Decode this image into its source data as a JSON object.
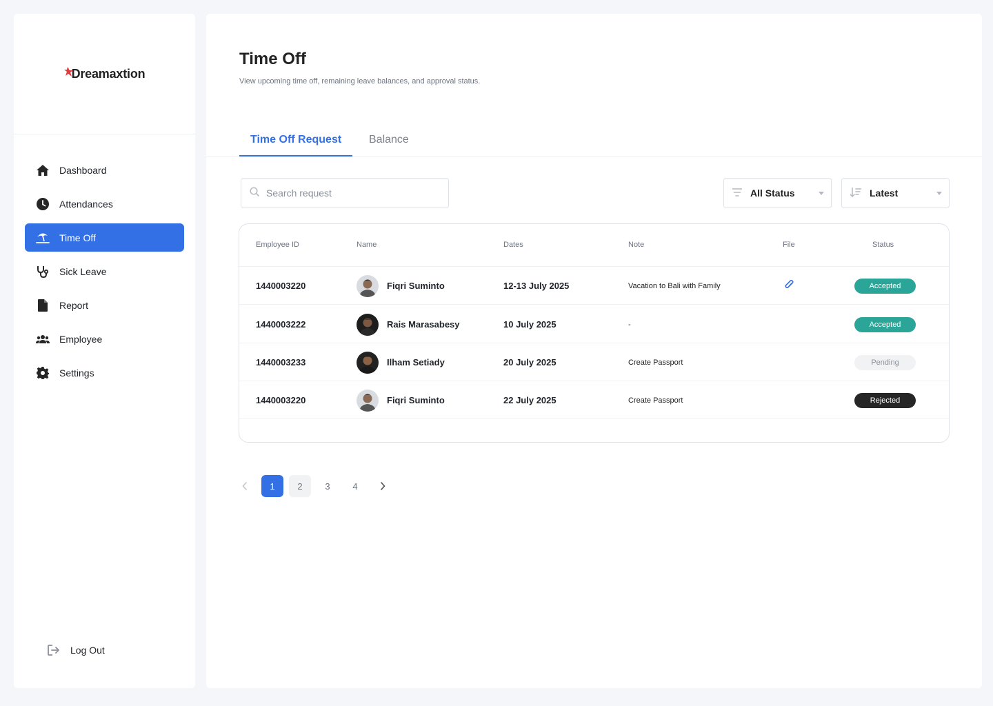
{
  "brand": {
    "logo_text": "Dreamaxtion",
    "accent": "#3370e6"
  },
  "sidebar": {
    "items": [
      {
        "label": "Dashboard",
        "icon": "home-icon"
      },
      {
        "label": "Attendances",
        "icon": "clock-icon"
      },
      {
        "label": "Time Off",
        "icon": "beach-umbrella-icon",
        "active": true
      },
      {
        "label": "Sick Leave",
        "icon": "stethoscope-icon"
      },
      {
        "label": "Report",
        "icon": "document-icon"
      },
      {
        "label": "Employee",
        "icon": "users-icon"
      },
      {
        "label": "Settings",
        "icon": "gear-icon"
      }
    ],
    "logout_label": "Log Out"
  },
  "header": {
    "title": "Time Off",
    "subtitle": "View upcoming time off, remaining leave balances, and approval status."
  },
  "tabs": [
    {
      "label": "Time Off Request",
      "active": true
    },
    {
      "label": "Balance",
      "active": false
    }
  ],
  "toolbar": {
    "search_placeholder": "Search request",
    "status_filter": "All Status",
    "sort": "Latest"
  },
  "table": {
    "columns": [
      "Employee ID",
      "Name",
      "Dates",
      "Note",
      "File",
      "Status"
    ],
    "rows": [
      {
        "id": "1440003220",
        "name": "Fiqri Suminto",
        "dates": "12-13 July 2025",
        "note": "Vacation to Bali with Family",
        "has_file": true,
        "status": "Accepted"
      },
      {
        "id": "1440003222",
        "name": "Rais Marasabesy",
        "dates": "10 July 2025",
        "note": "-",
        "has_file": false,
        "status": "Accepted"
      },
      {
        "id": "1440003233",
        "name": "Ilham Setiady",
        "dates": "20 July 2025",
        "note": "Create Passport",
        "has_file": false,
        "status": "Pending"
      },
      {
        "id": "1440003220",
        "name": "Fiqri Suminto",
        "dates": "22 July 2025",
        "note": "Create Passport",
        "has_file": false,
        "status": "Rejected"
      }
    ]
  },
  "pagination": {
    "pages": [
      "1",
      "2",
      "3",
      "4"
    ],
    "current": "1"
  },
  "status_colors": {
    "Accepted": "#2aa598",
    "Pending": "#f1f2f4",
    "Rejected": "#262626"
  }
}
